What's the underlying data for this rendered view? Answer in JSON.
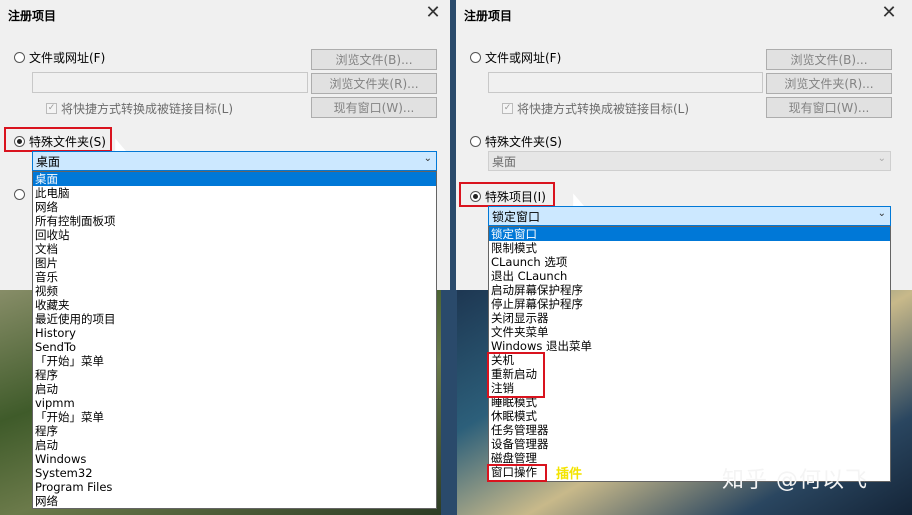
{
  "dialog_title": "注册项目",
  "options": {
    "file_or_url": "文件或网址(F)",
    "shortcut_checkbox": "将快捷方式转换成被链接目标(L)",
    "special_folder": "特殊文件夹(S)",
    "special_item": "特殊项目(I)"
  },
  "buttons": {
    "browse_file": "浏览文件(B)...",
    "browse_folder": "浏览文件夹(R)...",
    "existing_window": "现有窗口(W)..."
  },
  "left": {
    "combo_value": "桌面",
    "list": [
      "桌面",
      "此电脑",
      "网络",
      "所有控制面板项",
      "回收站",
      "文档",
      "图片",
      "音乐",
      "视频",
      "收藏夹",
      "最近使用的项目",
      "History",
      "SendTo",
      "「开始」菜单",
      "程序",
      "启动",
      "vipmm",
      "「开始」菜单",
      "程序",
      "启动",
      "Windows",
      "System32",
      "Program Files",
      "网络"
    ]
  },
  "right": {
    "folder_combo_value": "桌面",
    "combo_value": "锁定窗口",
    "list": [
      "锁定窗口",
      "限制模式",
      "CLaunch 选项",
      "退出 CLaunch",
      "启动屏幕保护程序",
      "停止屏幕保护程序",
      "关闭显示器",
      "文件夹菜单",
      "Windows 退出菜单",
      "关机",
      "重新启动",
      "注销",
      "睡眠模式",
      "休眠模式",
      "任务管理器",
      "设备管理器",
      "磁盘管理",
      "窗口操作"
    ]
  },
  "annotation": "插件",
  "watermark": "知乎 @何以飞",
  "colors": {
    "selection": "#0078d7",
    "highlight_box": "#d9131e",
    "annotation": "#f3e400"
  }
}
